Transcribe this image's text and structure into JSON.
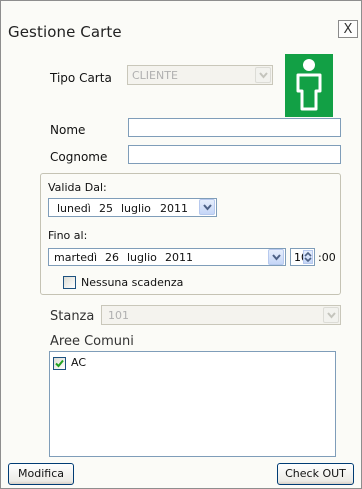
{
  "window": {
    "title": "Gestione Carte",
    "close_glyph": "X"
  },
  "tipo_carta": {
    "label": "Tipo Carta",
    "value": "CLIENTE"
  },
  "card_icon": {
    "name": "person-icon",
    "color": "#12a045"
  },
  "nome": {
    "label": "Nome",
    "value": ""
  },
  "cognome": {
    "label": "Cognome",
    "value": ""
  },
  "validity": {
    "valida_dal_label": "Valida Dal:",
    "from_date": {
      "weekday": "lunedì",
      "day": "25",
      "month": "luglio",
      "year": "2011"
    },
    "fino_al_label": "Fino al:",
    "to_date": {
      "weekday": "martedì",
      "day": "26",
      "month": "luglio",
      "year": "2011"
    },
    "hour": "10",
    "minutes_suffix": ":00",
    "no_expiry_label": "Nessuna scadenza",
    "no_expiry_checked": false
  },
  "stanza": {
    "label": "Stanza",
    "value": "101"
  },
  "aree_comuni": {
    "label": "Aree Comuni",
    "items": [
      {
        "label": "AC",
        "checked": true
      }
    ]
  },
  "buttons": {
    "modifica": "Modifica",
    "check_out": "Check OUT"
  },
  "colors": {
    "accent": "#12a045",
    "border": "#7f9db9"
  }
}
